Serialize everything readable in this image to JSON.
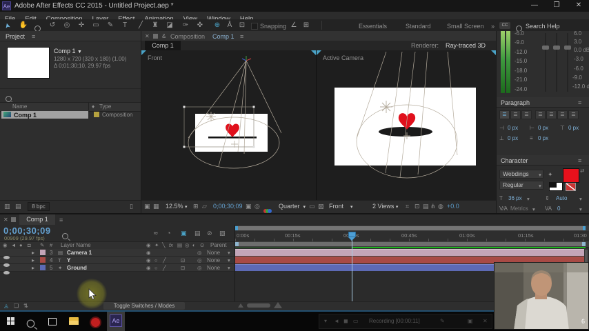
{
  "window": {
    "badge": "Ae",
    "title": "Adobe After Effects CC 2015 - Untitled Project.aep *",
    "minimize": "—",
    "maximize": "❐",
    "close": "✕"
  },
  "menus": [
    "File",
    "Edit",
    "Composition",
    "Layer",
    "Effect",
    "Animation",
    "View",
    "Window",
    "Help"
  ],
  "tools": [
    "➤",
    "✋",
    "↺",
    "◎",
    "✛",
    "▭",
    "✎",
    "T",
    "╱",
    "♜",
    "◪",
    "✑",
    "✜"
  ],
  "toolbar": {
    "axis": [
      "⊕",
      "Å",
      "⊡"
    ],
    "snapping": "Snapping",
    "angle_icons": [
      "∠",
      "⊞"
    ],
    "workspaces": [
      "Essentials",
      "Standard",
      "Small Screen"
    ],
    "overflow": "»",
    "search_help": "Search Help"
  },
  "project": {
    "tab": "Project",
    "menu_icon": "≡",
    "comp_name": "Comp 1",
    "caret": "▼",
    "line1": "1280 x 720  (320 x 180) (1.00)",
    "line2": "Δ 0;01;30;10, 29.97 fps",
    "col_name": "Name",
    "tag_icon": "♦",
    "col_type": "Type",
    "row_name": "Comp 1",
    "row_type": "Composition",
    "footer_icons": [
      "▥",
      "▤",
      "▯"
    ],
    "bpc": "8 bpc"
  },
  "comp": {
    "close": "✕",
    "lock": "&",
    "tab_kind": "Composition",
    "tab_name": "Comp 1",
    "menu_icon": "≡",
    "mini_tab": "Comp 1",
    "renderer_label": "Renderer:",
    "renderer_value": "Ray-traced 3D",
    "front_label": "Front",
    "cam_label": "Active Camera",
    "zoom": "12.5%",
    "caret": "▾",
    "grid_icon": "⊞",
    "guides_icon": "▱",
    "timecode": "0;00;30;09",
    "snapshot_icon": "▣",
    "show_icon": "◎",
    "resolution": "Quarter",
    "roi_icon": "▭",
    "alpha_icon": "▨",
    "view": "Front",
    "layout": "2 Views",
    "misc_icons": [
      "⌗",
      "⊡",
      "▤",
      "⋔",
      "◍"
    ],
    "exposure": "+0.0"
  },
  "audio": {
    "left": [
      "-6.0",
      "-9.0",
      "-12.0",
      "-15.0",
      "-18.0",
      "-21.0",
      "-24.0"
    ],
    "right": [
      "6.0",
      "3.0",
      "0.0 dB",
      "-3.0",
      "-6.0",
      "-9.0",
      "-12.0 dB"
    ]
  },
  "paragraph": {
    "title": "Paragraph",
    "menu_icon": "≡",
    "align_glyph": "☰",
    "row1_icons": [
      "⊣",
      "⊢",
      "⊤"
    ],
    "row1": [
      "0 px",
      "0 px",
      "0 px"
    ],
    "row2_icons": [
      "⊥",
      "≡"
    ],
    "row2": [
      "0 px",
      "0 px"
    ]
  },
  "character": {
    "title": "Character",
    "menu_icon": "≡",
    "font": "Webdings",
    "style": "Regular",
    "eyedropper_icon": "✦",
    "swap_icon": "⇄",
    "icons": [
      "T",
      "⇕",
      "V∕A",
      "VA"
    ],
    "size": "36 px",
    "leading": "Auto",
    "kerning": "Metrics",
    "tracking": "0",
    "caret": "▾"
  },
  "timeline": {
    "close": "✕",
    "tab": "Comp 1",
    "menu_icon": "≡",
    "timecode": "0;00;30;09",
    "frames": "00909 (29.97 fps)",
    "panel_icons": [
      "≂",
      "◔",
      "▣",
      "▤",
      "⊘",
      "▨"
    ],
    "flag_icons": [
      "◉",
      "◄",
      "●",
      "◘"
    ],
    "col_layer": "Layer Name",
    "header_icons": [
      "◉",
      "✦",
      "╲",
      "fx",
      "▤",
      "◎",
      "◐",
      "⊙"
    ],
    "col_parent": "Parent",
    "layers": [
      {
        "num": "3",
        "icon": "▤",
        "name": "Camera 1",
        "parent": "None",
        "switches": [
          "◉"
        ]
      },
      {
        "num": "4",
        "icon": "T",
        "name": "Y",
        "parent": "None",
        "switches": [
          "◉",
          "○",
          "╱"
        ]
      },
      {
        "num": "5",
        "icon": "✦",
        "name": "Ground",
        "parent": "None",
        "switches": [
          "◉",
          "○",
          "╱"
        ]
      }
    ],
    "pickwhip_icon": "◎",
    "caret": "▾",
    "ruler": [
      "0:00s",
      "00:15s",
      "00:30s",
      "00:45s",
      "01:00s",
      "01:15s",
      "01:30"
    ],
    "footer_icons": [
      "◬",
      "❏",
      "⇅"
    ],
    "toggle": "Toggle Switches / Modes"
  },
  "recorder": {
    "icons": [
      "▾",
      "◄",
      "◼",
      "▭"
    ],
    "status": "Recording [00:00:11]",
    "pen_icon": "✎",
    "cam_icon": "▣",
    "close_icon": "✕"
  },
  "overlay": {
    "badge": "6"
  },
  "colors": {
    "accent_blue": "#64a0cf",
    "heart_red": "#e0101c",
    "render_green": "#1db21e",
    "label_camera": "#c3a5b8",
    "label_y": "#a84a45",
    "label_ground": "#5d6ab5",
    "char_red": "#e8111c"
  }
}
